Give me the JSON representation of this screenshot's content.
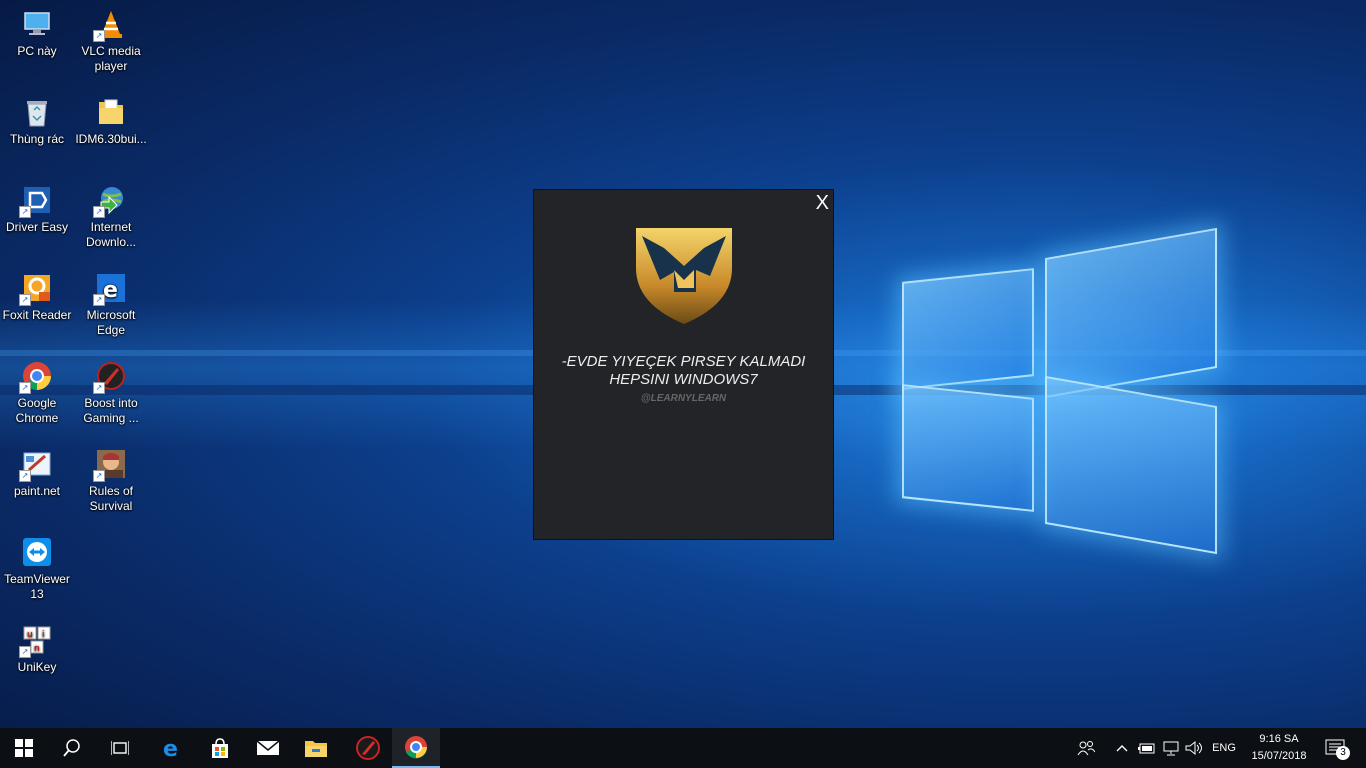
{
  "desktop_icons": [
    {
      "label": "PC này"
    },
    {
      "label": "VLC media player"
    },
    {
      "label": "Thùng rác"
    },
    {
      "label": "IDM6.30bui..."
    },
    {
      "label": "Driver Easy"
    },
    {
      "label": "Internet Downlo..."
    },
    {
      "label": "Foxit Reader"
    },
    {
      "label": "Microsoft Edge"
    },
    {
      "label": "Google Chrome"
    },
    {
      "label": "Boost into Gaming ..."
    },
    {
      "label": "paint.net"
    },
    {
      "label": "Rules of Survival"
    },
    {
      "label": "TeamViewer 13"
    },
    {
      "label": "UniKey"
    }
  ],
  "dialog": {
    "close_label": "X",
    "message_line1": "-EVDE YIYEÇEK PIRSEY KALMADI",
    "message_line2": "HEPSINI WINDOWS7",
    "handle": "@LEARNYLEARN"
  },
  "taskbar": {
    "tray_language": "ENG",
    "clock_time": "9:16 SA",
    "clock_date": "15/07/2018",
    "notification_count": "3"
  },
  "colors": {
    "taskbar_bg": "#0c0f14",
    "dialog_bg": "#222428",
    "accent": "#76b9ed"
  }
}
